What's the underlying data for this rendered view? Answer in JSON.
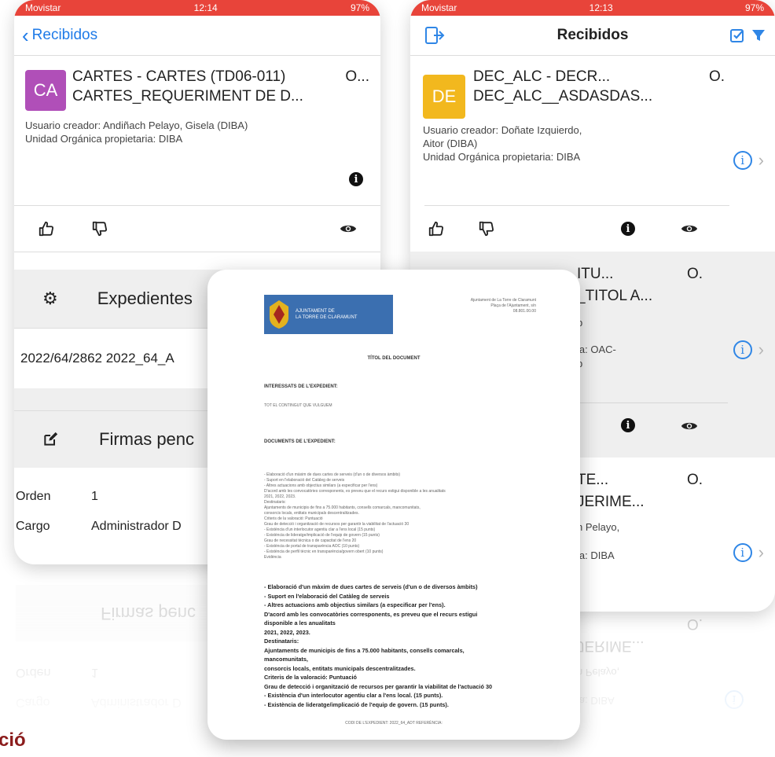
{
  "left_phone": {
    "status": {
      "carrier": "Movistar",
      "time": "12:14",
      "battery": "97%"
    },
    "nav": {
      "back_label": "Recibidos"
    },
    "card": {
      "avatar": "CA",
      "avatar_color": "#b04fb8",
      "title_line1": "CARTES - CARTES (TD06-011)",
      "title_line2": "CARTES_REQUERIMENT DE D...",
      "extra": "O...",
      "creator_label": "Usuario creador:",
      "creator_value": "Andiñach Pelayo, Gisela (DIBA)",
      "unit_label": "Unidad Orgánica propietaria:",
      "unit_value": "DIBA"
    },
    "sections": {
      "expedientes": "Expedientes",
      "expediente_row": "2022/64/2862 2022_64_A",
      "firmas": "Firmas penc"
    },
    "table": [
      {
        "label": "Orden",
        "value": "1"
      },
      {
        "label": "Cargo",
        "value": "Administrador D"
      }
    ]
  },
  "right_phone": {
    "status": {
      "carrier": "Movistar",
      "time": "12:13",
      "battery": "97%"
    },
    "nav": {
      "title": "Recibidos"
    },
    "items": [
      {
        "avatar": "DE",
        "avatar_color": "#f2b81e",
        "title_line1": "DEC_ALC - DECR...",
        "title_line2": "DEC_ALC__ASDASDAS...",
        "extra": "O.",
        "creator_label": "Usuario creador:",
        "creator_value": "Doñate Izquierdo,",
        "creator_value2": "Aitor (DIBA)",
        "unit_label": "Unidad Orgánica propietaria:",
        "unit_value": "DIBA"
      },
      {
        "title_line1": "ITU...",
        "title_line2": "_TITOL A...",
        "extra": "O.",
        "line_a": "b",
        "line_b": "ia:  OAC-",
        "line_c": "b"
      },
      {
        "title_line1": "TE...",
        "title_line2": "JERIME...",
        "extra": "O.",
        "line_a": "h Pelayo,",
        "line_b": "ia:  DIBA"
      }
    ]
  },
  "document": {
    "logo_line1": "AJUNTAMENT DE",
    "logo_line2": "LA TORRE DE CLARAMUNT",
    "logo_color": "#3b6fb0",
    "address_line1": "Ajuntament de La Torre de Claramunt",
    "address_line2": "Plaça de l'Ajuntament, s/n",
    "address_line3": "08.801.00.00",
    "title": "TÍTOL DEL DOCUMENT",
    "interessats": "INTERESSATS DE L'EXPEDIENT:",
    "interessats_text": "TOT EL CONTINGUT QUE VULGUEM",
    "documents": "DOCUMENTS DE L'EXPEDIENT:",
    "small_lines": [
      "- Elaboració d'un màxim de dues cartes de serveis (d'un o de diversos àmbits)",
      "- Suport en l'elaboració del Catàleg de serveis",
      "- Altres actuacions amb objectius similars (a especificar per l'ens)",
      "D'acord amb les convocatòries corresponents, es preveu que el recurs estigui disponible a les anualitats",
      "2021, 2022, 2023.",
      "Destinataris:",
      "Ajuntaments de municipis de fins a 75.000 habitants, consells comarcals, mancomunitats,",
      "consorcis locals, entitats municipals descentralitzades.",
      "Criteris de la valoració: Puntuació",
      "Grau de detecció i organització de recursos per garantir la viabilitat de l'actuació 30",
      "- Existència d'un interlocutor agentiu clar a l'ens local (15 punts)",
      "- Existència de lideratge/implicació de l'equip de govern (15 punts)",
      "Grau de necessitat tècnica o de capacitat de l'ens 20",
      "- Existència de portal de transparència AOC (10 punts)",
      "- Existència de perfil tècnic en transparència/govern obert (10 punts)",
      "Evidència"
    ],
    "large_lines": [
      "- Elaboració d'un màxim de dues cartes de serveis (d'un o de diversos àmbits)",
      "- Suport en l'elaboració del Catàleg de serveis",
      "- Altres actuacions amb objectius similars (a especificar per l'ens).",
      "D'acord amb les convocatòries corresponents, es preveu que el recurs estigui",
      "disponible a les anualitats",
      "2021, 2022, 2023.",
      "Destinataris:",
      "Ajuntaments de municipis de fins a 75.000 habitants, consells comarcals,",
      "mancomunitats,",
      "consorcis locals, entitats municipals descentralitzades.",
      "Criteris de la valoració: Puntuació",
      "Grau de detecció i organització de recursos per garantir la viabilitat de l'actuació 30",
      "- Existència d'un interlocutor agentiu clar a l'ens local. (15 punts).",
      "- Existència de lideratge/implicació de l'equip de govern. (15 punts)."
    ],
    "footer": "CODI DE L'EXPEDIENT: 2022_64_ADT   REFERÈNCIA: "
  },
  "bottom_text": "ció",
  "bottom_text_color": "#8b1c1c"
}
